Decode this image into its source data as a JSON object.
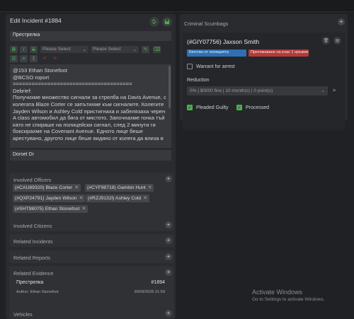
{
  "incident": {
    "header": "Edit Incident #1884",
    "title_value": "Престрелка",
    "toolbar": {
      "bold": "B",
      "italic": "I",
      "strike": "S",
      "select1": "Please Select",
      "select2": "Please Select"
    },
    "editor_lines": [
      "@153 Ethan Stonefoot",
      "@BCSO roport",
      "======================================",
      "Debrief:"
    ],
    "editor_body": "Получихме множество сигнали за стрелба на Davis Avenue, с колегата Blaze Corter се запътихме към сигналите. Колегите Jayden Wilson и Ashley Cold пристигнаха и забелязаха черен A class автомобил да бяга от мястото. Започнахме гонка тъй като не спираше на полицейски сигнал, след 2 минути ги боксирахме на Covenant Avenue. Едното лице беше арестувано, другото лице беше видяно от колега да влиза в",
    "street_value": "Dorset Dr"
  },
  "sections": {
    "involved_officers": {
      "title": "Involved Officers",
      "chips": [
        "(#CAU89320) Blaze Corter",
        "(#CYF98718) Gambin Hunt",
        "(#QXP24791) Jayden Wilson",
        "(#RZJ9132l) Ashley Cold",
        "(#SHT98075) Ethan Stonefoot"
      ]
    },
    "involved_citizens": {
      "title": "Involved Citizens"
    },
    "related_incidents": {
      "title": "Related Incidents"
    },
    "related_reports": {
      "title": "Related Reports"
    },
    "related_evidence": {
      "title": "Related Evidence",
      "item": {
        "title": "Престрелка",
        "id": "#1894",
        "author": "Author: Ethan Stonefoot",
        "date": "20/09/2026 21:59"
      }
    },
    "vehicles": {
      "title": "Vehicles"
    }
  },
  "scumbags": {
    "title": "Criminal Scumbags",
    "record": {
      "name": "(#GIY07756) Jaxson Smith",
      "charges": [
        {
          "label": "Бягство от полицията",
          "color": "#2f6fb3"
        },
        {
          "label": "Притежаване на клас 1 оръжие",
          "color": "#b33a3a"
        }
      ],
      "warrant_label": "Warrant for arrest",
      "warrant_checked": false,
      "reduction_label": "Reduction",
      "reduction_value": "0% | $0000 fine | 10 month(s) | 0 point(s)",
      "pleaded_guilty_label": "Pleaded Guilty",
      "pleaded_guilty_checked": true,
      "processed_label": "Processed",
      "processed_checked": true
    }
  },
  "watermark": {
    "title": "Activate Windows",
    "subtitle": "Go to Settings to activate Windows."
  },
  "colors": {
    "accent": "#4cae4f",
    "panel": "#2a2b2e",
    "background": "#202124"
  }
}
